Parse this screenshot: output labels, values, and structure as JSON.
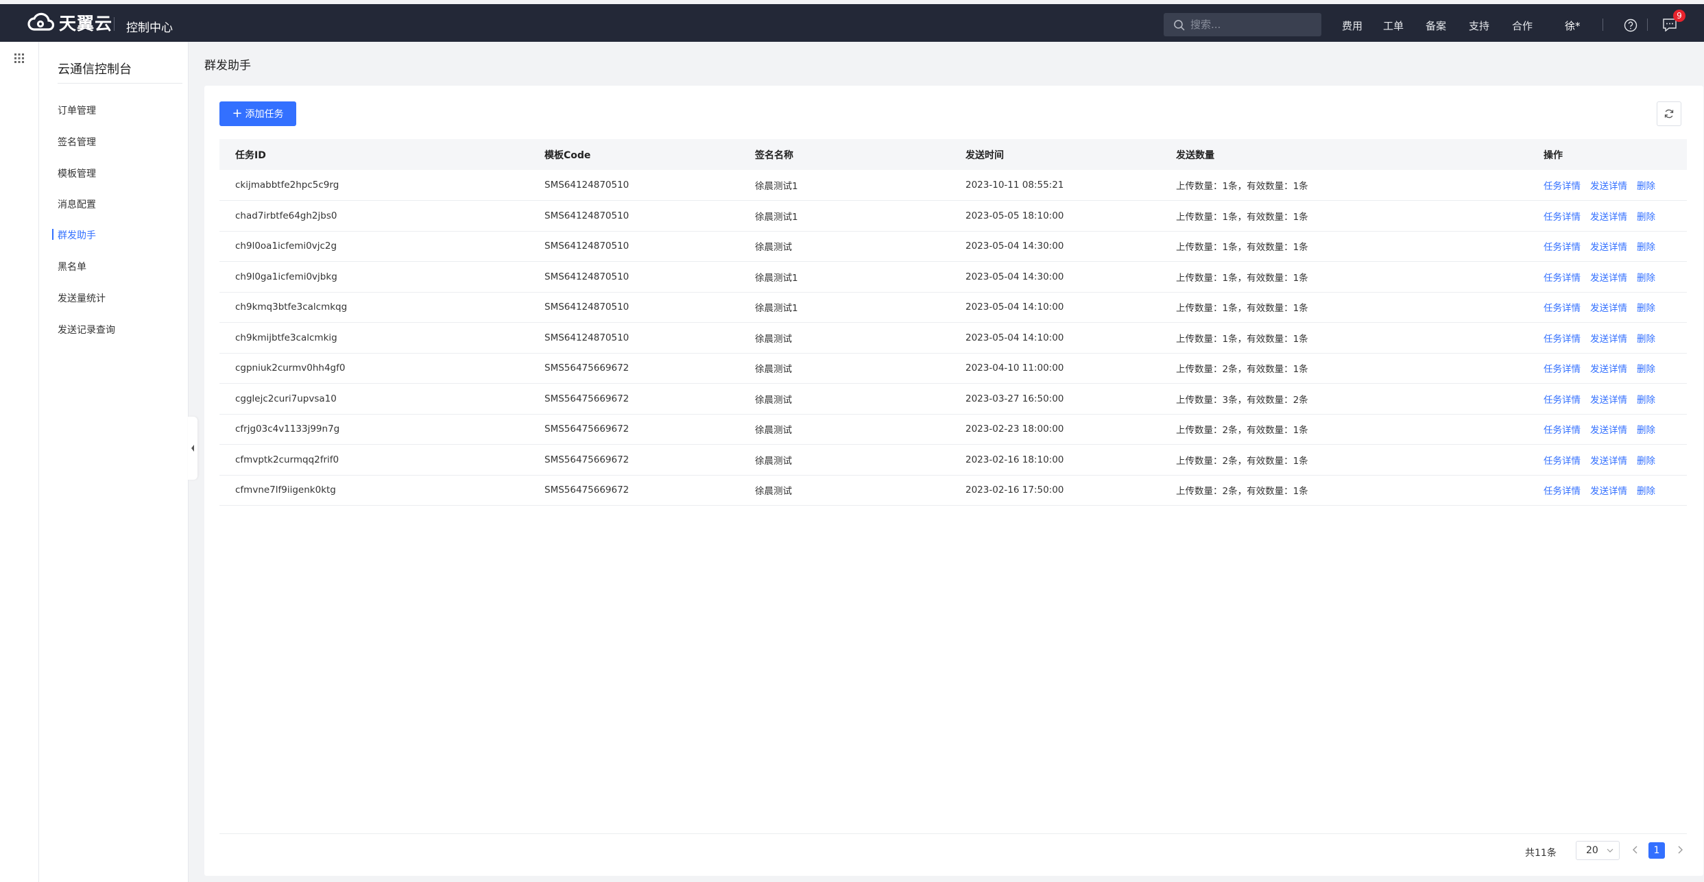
{
  "header": {
    "brand": "天翼云",
    "console_title": "控制中心",
    "search_placeholder": "搜索...",
    "nav": [
      "费用",
      "工单",
      "备案",
      "支持",
      "合作"
    ],
    "user": "徐*",
    "message_count": "9"
  },
  "sidebar": {
    "title": "云通信控制台",
    "items": [
      {
        "label": "订单管理"
      },
      {
        "label": "签名管理"
      },
      {
        "label": "模板管理"
      },
      {
        "label": "消息配置"
      },
      {
        "label": "群发助手",
        "active": true
      },
      {
        "label": "黑名单"
      },
      {
        "label": "发送量统计"
      },
      {
        "label": "发送记录查询"
      }
    ]
  },
  "page": {
    "title": "群发助手",
    "add_button": "添加任务"
  },
  "table": {
    "headers": [
      "任务ID",
      "模板Code",
      "签名名称",
      "发送时间",
      "发送数量",
      "操作"
    ],
    "actions": [
      "任务详情",
      "发送详情",
      "删除"
    ],
    "rows": [
      {
        "id": "ckijmabbtfe2hpc5c9rg",
        "code": "SMS64124870510",
        "sign": "徐晨测试1",
        "time": "2023-10-11 08:55:21",
        "count": "上传数量：1条，有效数量：1条"
      },
      {
        "id": "chad7irbtfe64gh2jbs0",
        "code": "SMS64124870510",
        "sign": "徐晨测试1",
        "time": "2023-05-05 18:10:00",
        "count": "上传数量：1条，有效数量：1条"
      },
      {
        "id": "ch9l0oa1icfemi0vjc2g",
        "code": "SMS64124870510",
        "sign": "徐晨测试",
        "time": "2023-05-04 14:30:00",
        "count": "上传数量：1条，有效数量：1条"
      },
      {
        "id": "ch9l0ga1icfemi0vjbkg",
        "code": "SMS64124870510",
        "sign": "徐晨测试1",
        "time": "2023-05-04 14:30:00",
        "count": "上传数量：1条，有效数量：1条"
      },
      {
        "id": "ch9kmq3btfe3calcmkqg",
        "code": "SMS64124870510",
        "sign": "徐晨测试1",
        "time": "2023-05-04 14:10:00",
        "count": "上传数量：1条，有效数量：1条"
      },
      {
        "id": "ch9kmijbtfe3calcmkig",
        "code": "SMS64124870510",
        "sign": "徐晨测试",
        "time": "2023-05-04 14:10:00",
        "count": "上传数量：1条，有效数量：1条"
      },
      {
        "id": "cgpniuk2curmv0hh4gf0",
        "code": "SMS56475669672",
        "sign": "徐晨测试",
        "time": "2023-04-10 11:00:00",
        "count": "上传数量：2条，有效数量：1条"
      },
      {
        "id": "cgglejc2curi7upvsa10",
        "code": "SMS56475669672",
        "sign": "徐晨测试",
        "time": "2023-03-27 16:50:00",
        "count": "上传数量：3条，有效数量：2条"
      },
      {
        "id": "cfrjg03c4v1133j99n7g",
        "code": "SMS56475669672",
        "sign": "徐晨测试",
        "time": "2023-02-23 18:00:00",
        "count": "上传数量：2条，有效数量：1条"
      },
      {
        "id": "cfmvptk2curmqq2frif0",
        "code": "SMS56475669672",
        "sign": "徐晨测试",
        "time": "2023-02-16 18:10:00",
        "count": "上传数量：2条，有效数量：1条"
      },
      {
        "id": "cfmvne7lf9iigenk0ktg",
        "code": "SMS56475669672",
        "sign": "徐晨测试",
        "time": "2023-02-16 17:50:00",
        "count": "上传数量：2条，有效数量：1条"
      }
    ]
  },
  "pagination": {
    "total": "共11条",
    "page_size": "20",
    "current": "1"
  },
  "colors": {
    "accent": "#3370ff",
    "topbar": "#232837",
    "badge": "#e8232d"
  }
}
